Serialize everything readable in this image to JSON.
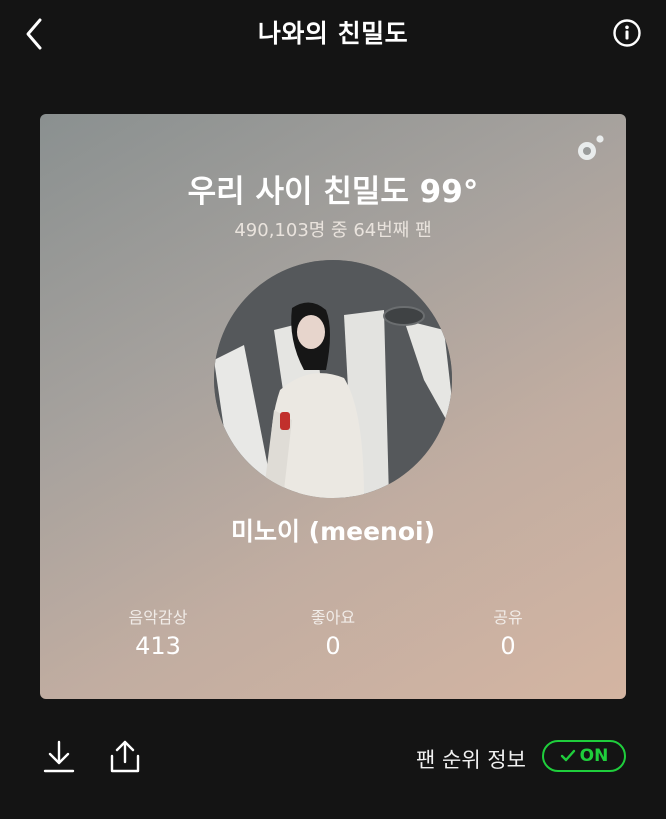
{
  "header": {
    "title": "나와의 친밀도",
    "back_icon": "chevron-left-icon",
    "info_icon": "info-icon"
  },
  "card": {
    "headline": "우리 사이 친밀도 99°",
    "subline": "490,103명 중 64번째 팬",
    "artist_name": "미노이 (meenoi)",
    "logo_icon": "brand-logo-icon",
    "stats": [
      {
        "label": "음악감상",
        "value": "413"
      },
      {
        "label": "좋아요",
        "value": "0"
      },
      {
        "label": "공유",
        "value": "0"
      }
    ]
  },
  "bottom": {
    "download_icon": "download-icon",
    "share_icon": "share-icon",
    "rank_label": "팬 순위 정보",
    "toggle_label": "ON",
    "toggle_state": true
  },
  "colors": {
    "background": "#141414",
    "accent_green": "#1fce3c"
  }
}
